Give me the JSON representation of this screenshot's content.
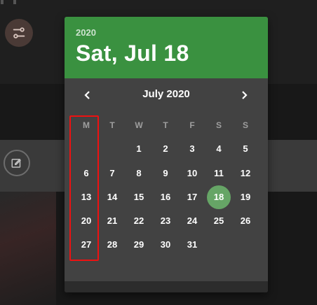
{
  "header": {
    "year": "2020",
    "selected_date": "Sat, Jul 18"
  },
  "nav": {
    "month_label": "July 2020",
    "prev_icon": "chevron-left-icon",
    "next_icon": "chevron-right-icon"
  },
  "weekdays": [
    "M",
    "T",
    "W",
    "T",
    "F",
    "S",
    "S"
  ],
  "weeks": [
    [
      "",
      "",
      "1",
      "2",
      "3",
      "4",
      "5"
    ],
    [
      "6",
      "7",
      "8",
      "9",
      "10",
      "11",
      "12"
    ],
    [
      "13",
      "14",
      "15",
      "16",
      "17",
      "18",
      "19"
    ],
    [
      "20",
      "21",
      "22",
      "23",
      "24",
      "25",
      "26"
    ],
    [
      "27",
      "28",
      "29",
      "30",
      "31",
      "",
      ""
    ]
  ],
  "selected_day": "18",
  "colors": {
    "header_bg": "#3a9140",
    "selected_bg": "#66a566",
    "highlight_border": "#ee1111",
    "panel_bg": "#424242"
  },
  "background_icons": [
    "filter-settings-icon",
    "edit-image-icon"
  ]
}
